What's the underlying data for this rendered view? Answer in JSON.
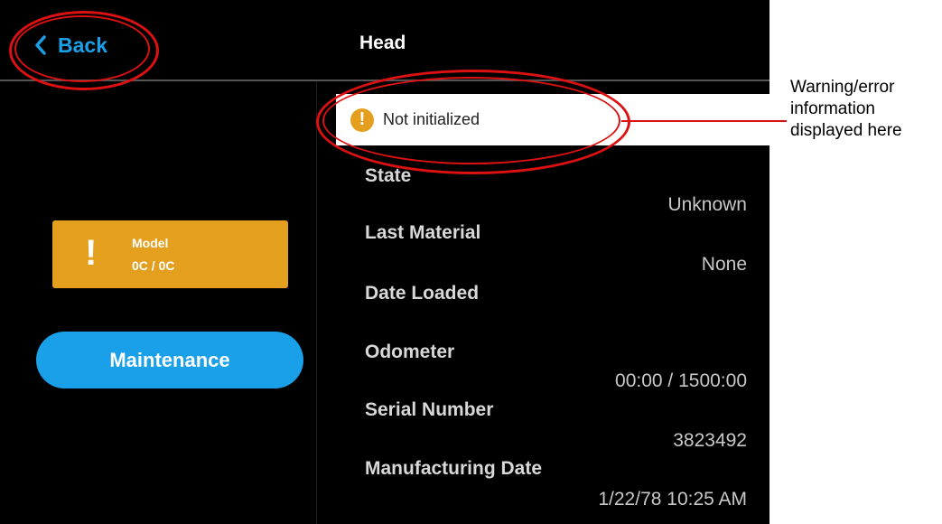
{
  "header": {
    "back_label": "Back",
    "title": "Head"
  },
  "warning": {
    "icon": "exclamation-circle-icon",
    "text": "Not initialized"
  },
  "model_card": {
    "name": "Model",
    "amount": "0C / 0C",
    "icon": "exclamation-icon",
    "color": "#e59f1f"
  },
  "maintenance_button": {
    "label": "Maintenance",
    "color": "#1aa0e8"
  },
  "details": [
    {
      "label": "State",
      "value": "Unknown"
    },
    {
      "label": "Last Material",
      "value": "None"
    },
    {
      "label": "Date Loaded",
      "value": ""
    },
    {
      "label": "Odometer",
      "value": "00:00 / 1500:00"
    },
    {
      "label": "Serial Number",
      "value": "3823492"
    },
    {
      "label": "Manufacturing Date",
      "value": "1/22/78 10:25 AM"
    }
  ],
  "annotation": {
    "text": "Warning/error information displayed here"
  }
}
